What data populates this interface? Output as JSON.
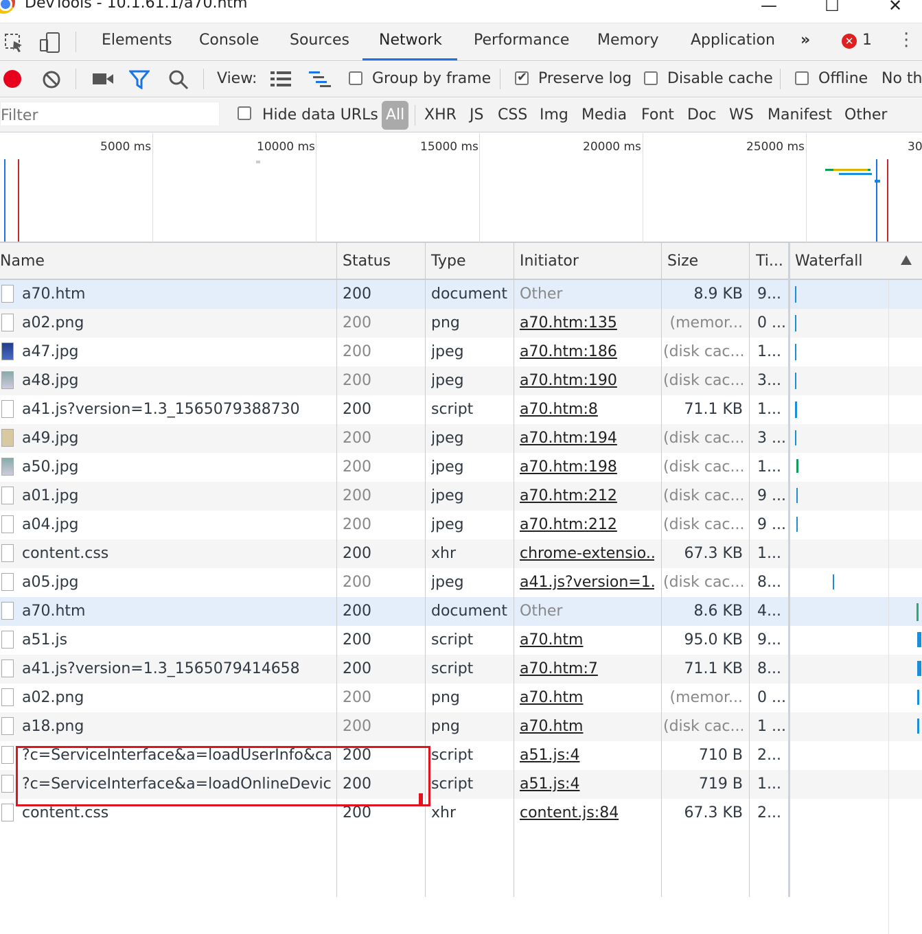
{
  "window": {
    "title": "DevTools - 10.1.61.1/a70.htm",
    "minimize": "—",
    "maximize": "☐",
    "close": "✕"
  },
  "tabs": [
    {
      "label": "Elements"
    },
    {
      "label": "Console"
    },
    {
      "label": "Sources"
    },
    {
      "label": "Network"
    },
    {
      "label": "Performance"
    },
    {
      "label": "Memory"
    },
    {
      "label": "Application"
    }
  ],
  "tabs_more": "»",
  "error_count": "1",
  "toolbar": {
    "view_label": "View:",
    "group_by_frame": "Group by frame",
    "group_by_frame_checked": false,
    "preserve_log": "Preserve log",
    "preserve_log_checked": true,
    "disable_cache": "Disable cache",
    "disable_cache_checked": false,
    "offline": "Offline",
    "throttling": "No th"
  },
  "filter": {
    "placeholder": "Filter",
    "hide_data_urls": "Hide data URLs",
    "types": [
      "All",
      "XHR",
      "JS",
      "CSS",
      "Img",
      "Media",
      "Font",
      "Doc",
      "WS",
      "Manifest",
      "Other"
    ],
    "selected": "All"
  },
  "overview": {
    "ticks": [
      "5000 ms",
      "10000 ms",
      "15000 ms",
      "20000 ms",
      "25000 ms",
      "30"
    ]
  },
  "columns": [
    "Name",
    "Status",
    "Type",
    "Initiator",
    "Size",
    "Ti...",
    "Waterfall"
  ],
  "rows": [
    {
      "name": "a70.htm",
      "status": "200",
      "type": "document",
      "initiator": "Other",
      "size": "8.9 KB",
      "time": "9..."
    },
    {
      "name": "a02.png",
      "status": "200",
      "type": "png",
      "initiator": "a70.htm:135",
      "size": "(memor...",
      "time": "0 ..."
    },
    {
      "name": "a47.jpg",
      "status": "200",
      "type": "jpeg",
      "initiator": "a70.htm:186",
      "size": "(disk cac...",
      "time": "1..."
    },
    {
      "name": "a48.jpg",
      "status": "200",
      "type": "jpeg",
      "initiator": "a70.htm:190",
      "size": "(disk cac...",
      "time": "3..."
    },
    {
      "name": "a41.js?version=1.3_1565079388730",
      "status": "200",
      "type": "script",
      "initiator": "a70.htm:8",
      "size": "71.1 KB",
      "time": "1..."
    },
    {
      "name": "a49.jpg",
      "status": "200",
      "type": "jpeg",
      "initiator": "a70.htm:194",
      "size": "(disk cac...",
      "time": "3 ..."
    },
    {
      "name": "a50.jpg",
      "status": "200",
      "type": "jpeg",
      "initiator": "a70.htm:198",
      "size": "(disk cac...",
      "time": "1..."
    },
    {
      "name": "a01.jpg",
      "status": "200",
      "type": "jpeg",
      "initiator": "a70.htm:212",
      "size": "(disk cac...",
      "time": "9 ..."
    },
    {
      "name": "a04.jpg",
      "status": "200",
      "type": "jpeg",
      "initiator": "a70.htm:212",
      "size": "(disk cac...",
      "time": "9 ..."
    },
    {
      "name": "content.css",
      "status": "200",
      "type": "xhr",
      "initiator": "chrome-extensio...",
      "size": "67.3 KB",
      "time": "1..."
    },
    {
      "name": "a05.jpg",
      "status": "200",
      "type": "jpeg",
      "initiator": "a41.js?version=1...",
      "size": "(disk cac...",
      "time": "8..."
    },
    {
      "name": "a70.htm",
      "status": "200",
      "type": "document",
      "initiator": "Other",
      "size": "8.6 KB",
      "time": "4..."
    },
    {
      "name": "a51.js",
      "status": "200",
      "type": "script",
      "initiator": "a70.htm",
      "size": "95.0 KB",
      "time": "9..."
    },
    {
      "name": "a41.js?version=1.3_1565079414658",
      "status": "200",
      "type": "script",
      "initiator": "a70.htm:7",
      "size": "71.1 KB",
      "time": "8..."
    },
    {
      "name": "a02.png",
      "status": "200",
      "type": "png",
      "initiator": "a70.htm",
      "size": "(memor...",
      "time": "0 ..."
    },
    {
      "name": "a18.png",
      "status": "200",
      "type": "png",
      "initiator": "a70.htm",
      "size": "(disk cac...",
      "time": "1 ..."
    },
    {
      "name": "?c=ServiceInterface&a=loadUserInfo&ca...",
      "status": "200",
      "type": "script",
      "initiator": "a51.js:4",
      "size": "710 B",
      "time": "2..."
    },
    {
      "name": "?c=ServiceInterface&a=loadOnlineDevic...",
      "status": "200",
      "type": "script",
      "initiator": "a51.js:4",
      "size": "719 B",
      "time": "1..."
    },
    {
      "name": "content.css",
      "status": "200",
      "type": "xhr",
      "initiator": "content.js:84",
      "size": "67.3 KB",
      "time": "2..."
    }
  ],
  "colors": {
    "accent": "#1a73e8",
    "record": "#e8001c",
    "annotation": "#e0141e"
  }
}
